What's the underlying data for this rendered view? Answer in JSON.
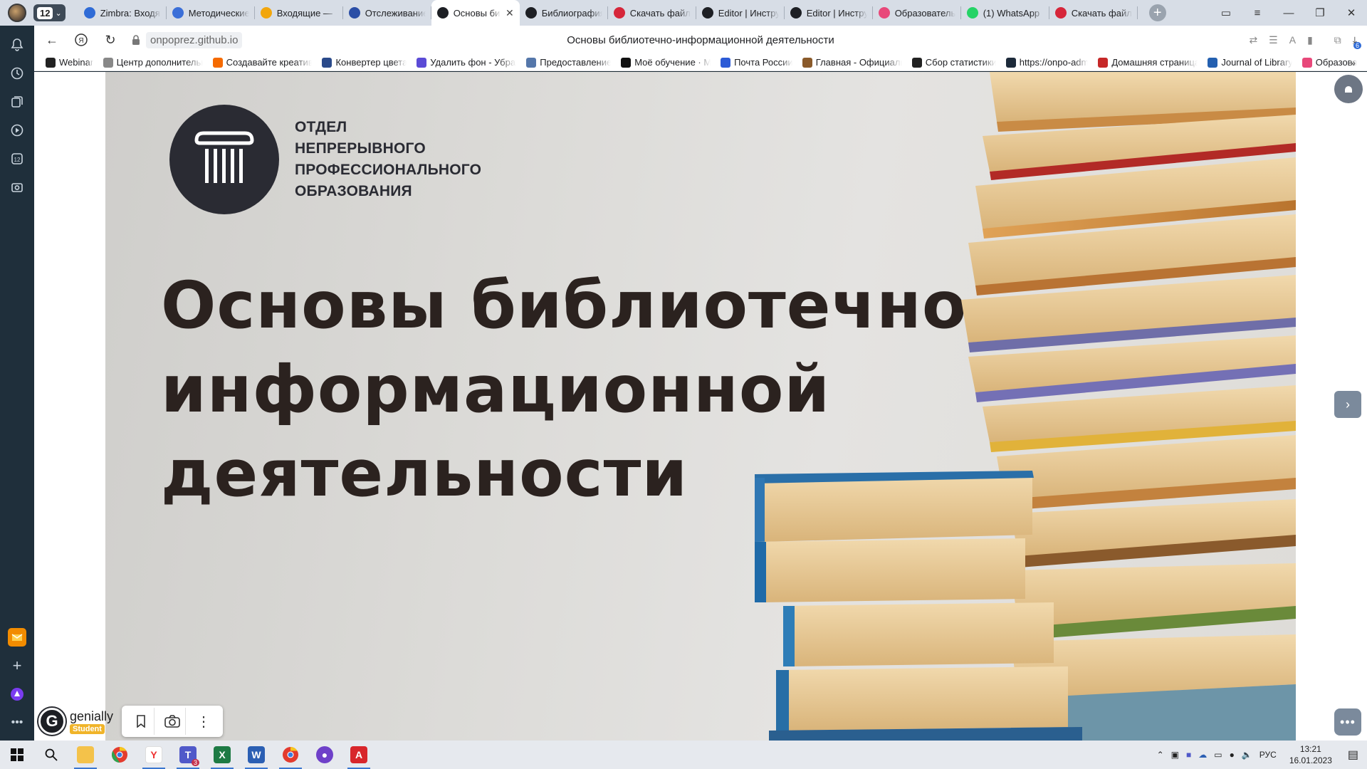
{
  "browser": {
    "tab_count": "12",
    "tabs": [
      {
        "title": "Zimbra: Входящие",
        "favicon": "zimbra-icon",
        "color": "#2f6bd6",
        "active": false
      },
      {
        "title": "Методические",
        "favicon": "os-icon",
        "color": "#3b6fd8",
        "active": false
      },
      {
        "title": "Входящие — ",
        "favicon": "mail-icon",
        "color": "#f2a60c",
        "active": false
      },
      {
        "title": "Отслеживание",
        "favicon": "tracking-icon",
        "color": "#2b4ea6",
        "active": false
      },
      {
        "title": "Основы библиотечно",
        "favicon": "genially-icon",
        "color": "#1d1f24",
        "active": true
      },
      {
        "title": "Библиография",
        "favicon": "genially-icon",
        "color": "#1d1f24",
        "active": false
      },
      {
        "title": "Скачать файл",
        "favicon": "heart-icon",
        "color": "#d6263a",
        "active": false
      },
      {
        "title": "Editor | Инструменты",
        "favicon": "genially-icon",
        "color": "#1d1f24",
        "active": false
      },
      {
        "title": "Editor | Инструменты",
        "favicon": "genially-icon",
        "color": "#1d1f24",
        "active": false
      },
      {
        "title": "Образовательный",
        "favicon": "edu-icon",
        "color": "#e8487a",
        "active": false
      },
      {
        "title": "(1) WhatsApp",
        "favicon": "whatsapp-icon",
        "color": "#25d366",
        "active": false
      },
      {
        "title": "Скачать файл",
        "favicon": "heart-icon",
        "color": "#d6263a",
        "active": false
      }
    ],
    "window_controls": {
      "minimize": "—",
      "maximize": "❐",
      "close": "✕"
    },
    "url": "onpoprez.github.io",
    "page_title": "Основы библиотечно-информационной деятельности",
    "downloads_badge": "6",
    "bookmarks": [
      {
        "label": "Webinar",
        "color": "#222"
      },
      {
        "label": "Центр дополнительного",
        "color": "#888"
      },
      {
        "label": "Создавайте креатив",
        "color": "#f56a00"
      },
      {
        "label": "Конвертер цвета",
        "color": "#2a4a8a"
      },
      {
        "label": "Удалить фон - Убрать",
        "color": "#5b4bd6"
      },
      {
        "label": "Предоставление",
        "color": "#5577aa"
      },
      {
        "label": "Моё обучение · М",
        "color": "#111"
      },
      {
        "label": "Почта России",
        "color": "#2c5bd6"
      },
      {
        "label": "Главная - Официальный",
        "color": "#8a5a2a"
      },
      {
        "label": "Сбор статистики",
        "color": "#222"
      },
      {
        "label": "https://onpo-adm",
        "color": "#1d2a3a"
      },
      {
        "label": "Домашняя страница",
        "color": "#c62828"
      },
      {
        "label": "Journal of Library",
        "color": "#2460b0"
      },
      {
        "label": "Образова",
        "color": "#e8487a"
      }
    ]
  },
  "slide": {
    "logo_lines": [
      "ОТДЕЛ",
      "НЕПРЕРЫВНОГО",
      "ПРОФЕССИОНАЛЬНОГО",
      "ОБРАЗОВАНИЯ"
    ],
    "title_lines": [
      "Основы библиотечно-",
      "информационной",
      "деятельности"
    ]
  },
  "genially": {
    "name": "genially",
    "badge": "Student"
  },
  "taskbar": {
    "language": "РУС",
    "time": "13:21",
    "date": "16.01.2023",
    "teams_badge": "3"
  }
}
